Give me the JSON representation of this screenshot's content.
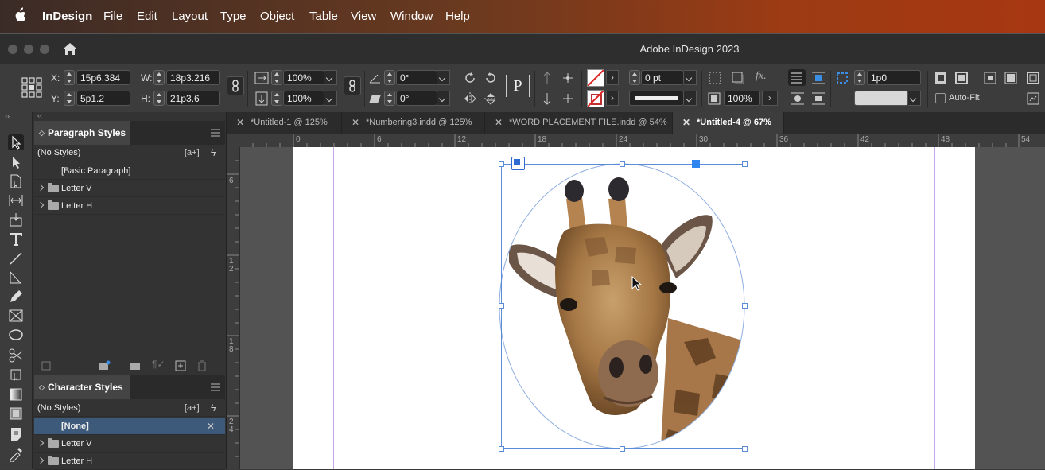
{
  "menubar": {
    "app_name": "InDesign",
    "items": [
      "File",
      "Edit",
      "Layout",
      "Type",
      "Object",
      "Table",
      "View",
      "Window",
      "Help"
    ]
  },
  "window": {
    "title": "Adobe InDesign 2023"
  },
  "control_bar": {
    "x_label": "X:",
    "x_value": "15p6.384",
    "y_label": "Y:",
    "y_value": "5p1.2",
    "w_label": "W:",
    "w_value": "18p3.216",
    "h_label": "H:",
    "h_value": "21p3.6",
    "scale_x": "100%",
    "scale_y": "100%",
    "rotate": "0°",
    "shear": "0°",
    "stroke_weight": "0 pt",
    "opacity": "100%",
    "gutter": "1p0",
    "autofit_label": "Auto-Fit"
  },
  "panels": {
    "paragraph_styles": {
      "title": "Paragraph Styles",
      "current": "(No Styles)",
      "items": [
        {
          "label": "[Basic Paragraph]",
          "type": "style"
        },
        {
          "label": "Letter V",
          "type": "group"
        },
        {
          "label": "Letter H",
          "type": "group"
        }
      ]
    },
    "character_styles": {
      "title": "Character Styles",
      "current": "(No Styles)",
      "items": [
        {
          "label": "[None]",
          "type": "style",
          "selected": true
        },
        {
          "label": "Letter V",
          "type": "group"
        },
        {
          "label": "Letter H",
          "type": "group"
        }
      ]
    }
  },
  "doc_tabs": [
    {
      "label": "*Untitled-1 @ 125%",
      "active": false
    },
    {
      "label": "*Numbering3.indd @ 125%",
      "active": false
    },
    {
      "label": "*WORD PLACEMENT FILE.indd @ 54%",
      "active": false
    },
    {
      "label": "*Untitled-4 @ 67%",
      "active": true
    }
  ],
  "ruler": {
    "h_ticks": [
      "0",
      "6",
      "12",
      "18",
      "24",
      "30",
      "36",
      "42",
      "48",
      "54"
    ],
    "v_ticks": [
      "6",
      "1 2",
      "1 8",
      "2 4"
    ]
  },
  "colors": {
    "selection": "#5b8dd6",
    "active_tab": "#3d3d3d",
    "selected_row": "#3e5a7a"
  }
}
